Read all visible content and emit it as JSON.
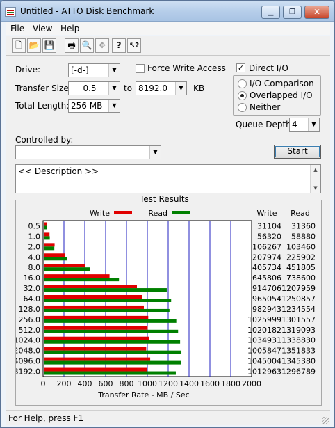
{
  "window": {
    "title": "Untitled - ATTO Disk Benchmark",
    "buttons": {
      "minimize": "▁",
      "maximize": "❐",
      "close": "✕"
    }
  },
  "menu": [
    "File",
    "View",
    "Help"
  ],
  "toolbar": [
    {
      "name": "new",
      "glyph": "🗋"
    },
    {
      "name": "open",
      "glyph": "📂"
    },
    {
      "name": "save",
      "glyph": "💾"
    },
    {
      "name": "print",
      "glyph": "🖶"
    },
    {
      "name": "print-preview",
      "glyph": "🔍"
    },
    {
      "name": "move",
      "glyph": "✥"
    },
    {
      "name": "about",
      "glyph": "?"
    },
    {
      "name": "context-help",
      "glyph": "↖?"
    }
  ],
  "form": {
    "drive_label": "Drive:",
    "drive_value": "[-d-]",
    "transfer_size_label": "Transfer Size:",
    "transfer_from": "0.5",
    "transfer_to_label": "to",
    "transfer_to": "8192.0",
    "transfer_unit": "KB",
    "total_length_label": "Total Length:",
    "total_length": "256 MB",
    "force_write_label": "Force Write Access",
    "force_write_checked": false,
    "direct_io_label": "Direct I/O",
    "direct_io_checked": true,
    "io_mode_options": [
      "I/O Comparison",
      "Overlapped I/O",
      "Neither"
    ],
    "io_mode_selected": 1,
    "queue_depth_label": "Queue Depth:",
    "queue_depth": "4",
    "controlled_by_label": "Controlled by:",
    "controlled_by_value": "",
    "start_label": "Start",
    "description": "<< Description >>"
  },
  "results": {
    "title": "Test Results",
    "write_col": "Write",
    "read_col": "Read",
    "status": "For Help, press F1"
  },
  "colors": {
    "write": "#e00000",
    "read": "#008000",
    "grid": "#2020c0"
  },
  "chart_data": {
    "type": "bar",
    "orientation": "horizontal",
    "xlabel": "Transfer Rate - MB / Sec",
    "xlim": [
      0,
      2000
    ],
    "xticks": [
      0,
      200,
      400,
      600,
      800,
      1000,
      1200,
      1400,
      1600,
      1800,
      2000
    ],
    "categories": [
      "0.5",
      "1.0",
      "2.0",
      "4.0",
      "8.0",
      "16.0",
      "32.0",
      "64.0",
      "128.0",
      "256.0",
      "512.0",
      "1024.0",
      "2048.0",
      "4096.0",
      "8192.0"
    ],
    "series": [
      {
        "name": "Write",
        "values_kb_s": [
          31104,
          56320,
          106267,
          207974,
          405734,
          645806,
          914706,
          965054,
          982943,
          1025999,
          1020182,
          1034931,
          1005847,
          1045004,
          1012963
        ]
      },
      {
        "name": "Read",
        "values_kb_s": [
          31360,
          58880,
          103460,
          225902,
          451805,
          738600,
          1207959,
          1250857,
          1234554,
          1301557,
          1319093,
          1338830,
          1351833,
          1345380,
          1296789
        ]
      }
    ]
  }
}
